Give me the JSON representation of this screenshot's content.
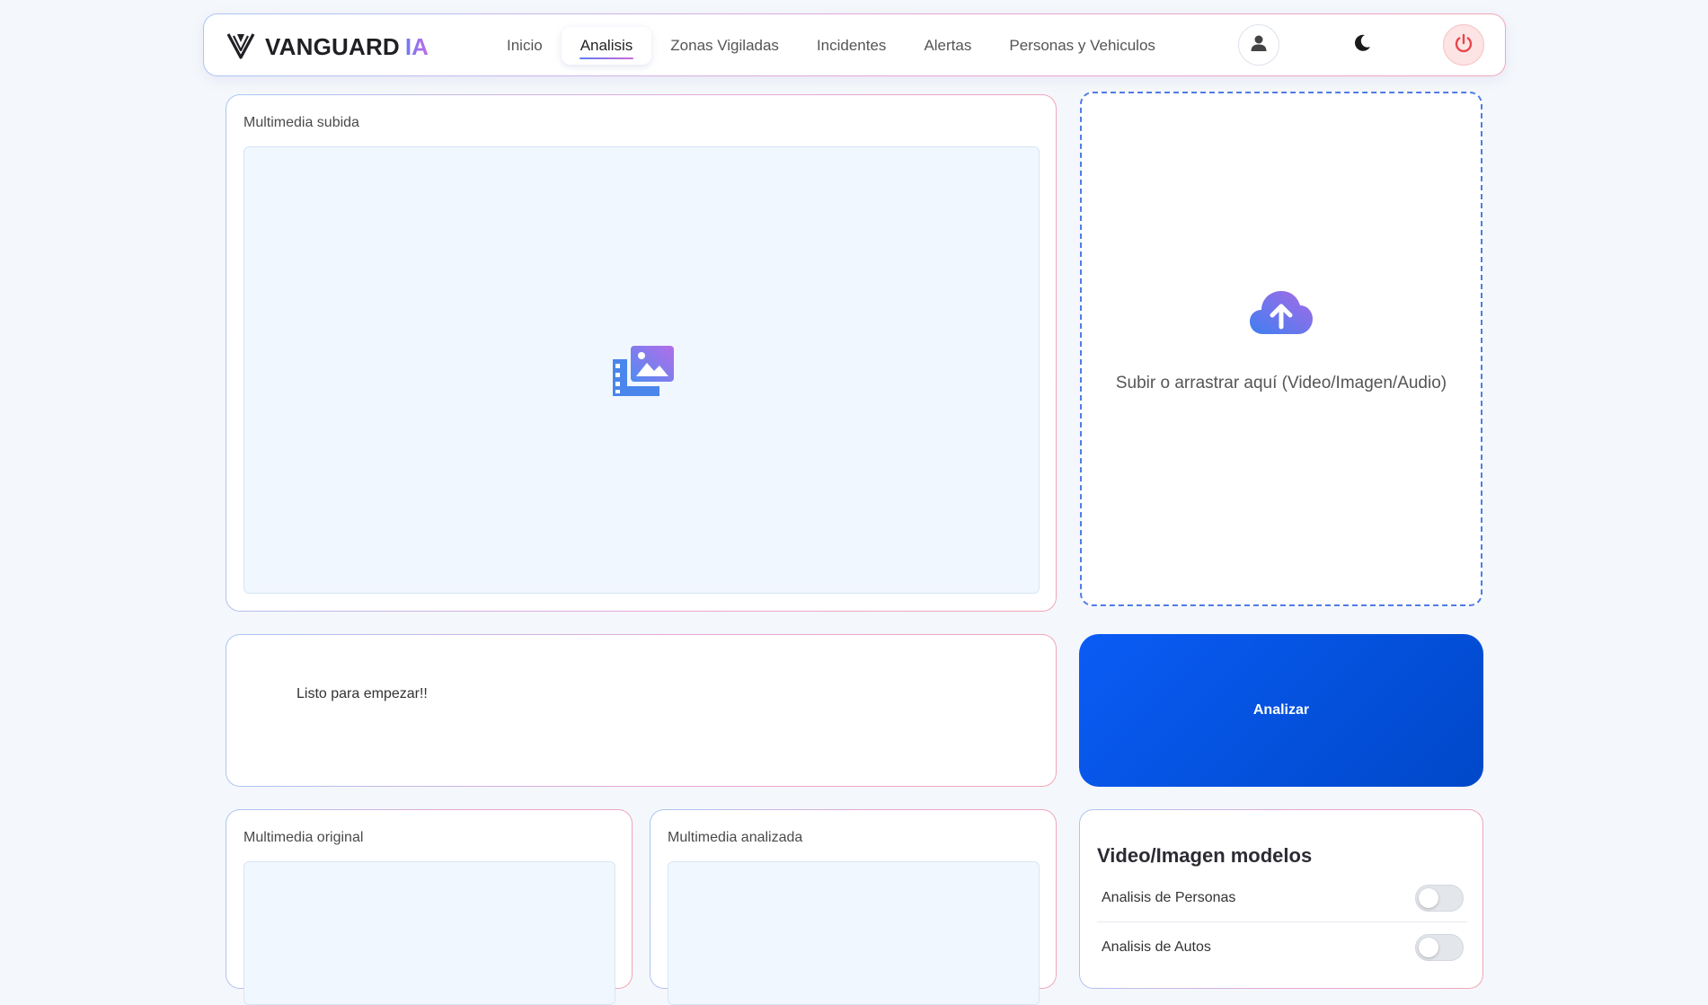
{
  "brand": {
    "name": "VANGUARD",
    "accent": "IA",
    "logo_icon": "v-shield-icon"
  },
  "nav": {
    "items": [
      {
        "label": "Inicio",
        "active": false
      },
      {
        "label": "Analisis",
        "active": true
      },
      {
        "label": "Zonas Vigiladas",
        "active": false
      },
      {
        "label": "Incidentes",
        "active": false
      },
      {
        "label": "Alertas",
        "active": false
      },
      {
        "label": "Personas y Vehiculos",
        "active": false
      }
    ],
    "icons": [
      "user-icon",
      "moon-icon",
      "power-icon"
    ]
  },
  "uploaded_media": {
    "title": "Multimedia subida",
    "icon": "media-gallery-icon"
  },
  "upload_zone": {
    "text": "Subir o arrastrar aquí (Video/Imagen/Audio)",
    "icon": "cloud-upload-icon"
  },
  "status": {
    "text": "Listo para empezar!!"
  },
  "analyze": {
    "label": "Analizar"
  },
  "original_media": {
    "title": "Multimedia original"
  },
  "analyzed_media": {
    "title": "Multimedia analizada"
  },
  "models": {
    "title": "Video/Imagen modelos",
    "items": [
      {
        "label": "Analisis de Personas",
        "enabled": false
      },
      {
        "label": "Analisis de Autos",
        "enabled": false
      }
    ]
  },
  "colors": {
    "accent_blue": "#0a5cf5",
    "upload_border": "#4f7ce6",
    "power_bg": "#fde4e4",
    "power_icon": "#e5484d",
    "gradient_start": "#5a7cf2",
    "gradient_end": "#c36be8"
  }
}
